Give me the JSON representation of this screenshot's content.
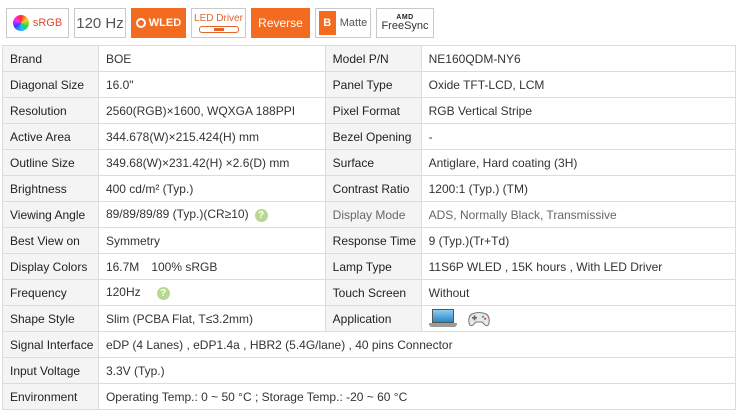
{
  "badges": {
    "srgb": "sRGB",
    "hz": "120 Hz",
    "wled": "WLED",
    "led_driver": "LED Driver",
    "reverse": "Reverse",
    "matte_letter": "B",
    "matte": "Matte",
    "amd": "AMD",
    "freesync": "FreeSync"
  },
  "specs": {
    "brand_label": "Brand",
    "brand_value": "BOE",
    "model_label": "Model P/N",
    "model_value": "NE160QDM-NY6",
    "diagonal_label": "Diagonal Size",
    "diagonal_value": "16.0\"",
    "panel_type_label": "Panel Type",
    "panel_type_value": "Oxide TFT-LCD, LCM",
    "resolution_label": "Resolution",
    "resolution_value": "2560(RGB)×1600, WQXGA  188PPI",
    "pixel_format_label": "Pixel Format",
    "pixel_format_value": "RGB Vertical Stripe",
    "active_area_label": "Active Area",
    "active_area_value": "344.678(W)×215.424(H) mm",
    "bezel_label": "Bezel Opening",
    "bezel_value": "-",
    "outline_label": "Outline Size",
    "outline_value": "349.68(W)×231.42(H) ×2.6(D) mm",
    "surface_label": "Surface",
    "surface_value": "Antiglare, Hard coating (3H)",
    "brightness_label": "Brightness",
    "brightness_value": "400 cd/m² (Typ.)",
    "contrast_label": "Contrast Ratio",
    "contrast_value": "1200:1 (Typ.) (TM)",
    "viewing_label": "Viewing Angle",
    "viewing_value": "89/89/89/89 (Typ.)(CR≥10)",
    "display_mode_label": "Display Mode",
    "display_mode_value": "ADS, Normally Black, Transmissive",
    "best_view_label": "Best View on",
    "best_view_value": "Symmetry",
    "response_label": "Response Time",
    "response_value": "9 (Typ.)(Tr+Td)",
    "colors_label": "Display Colors",
    "colors_value": "16.7M",
    "colors_gamut": "100% sRGB",
    "lamp_label": "Lamp Type",
    "lamp_value": "11S6P WLED , 15K hours , With LED Driver",
    "frequency_label": "Frequency",
    "frequency_value": "120Hz",
    "touch_label": "Touch Screen",
    "touch_value": "Without",
    "shape_label": "Shape Style",
    "shape_value": "Slim (PCBA Flat, T≤3.2mm)",
    "application_label": "Application",
    "signal_label": "Signal Interface",
    "signal_value": "eDP (4 Lanes) , eDP1.4a , HBR2 (5.4G/lane) , 40 pins Connector",
    "voltage_label": "Input Voltage",
    "voltage_value": "3.3V (Typ.)",
    "environment_label": "Environment",
    "environment_value": "Operating Temp.: 0 ~ 50 °C ; Storage Temp.: -20 ~ 60 °C"
  },
  "help_glyph": "?",
  "icons": {
    "application": [
      "laptop-icon",
      "gamepad-icon"
    ],
    "help": "help-icon"
  },
  "colors": {
    "accent_orange": "#f26b21",
    "label_bg": "#f4f4f4",
    "border": "#dcdcdc",
    "help_green": "#b7d98f"
  }
}
